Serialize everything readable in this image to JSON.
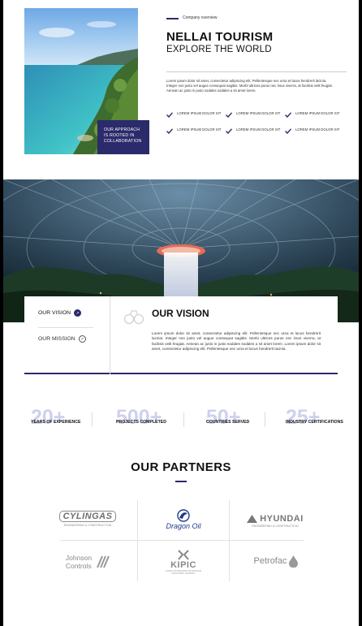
{
  "hero": {
    "approach_line1": "OUR APPROACH",
    "approach_line2": "IS ROOTED IN",
    "approach_line3": "COLLABORATION",
    "eyebrow": "Company overview",
    "title": "NELLAI TOURISM",
    "subtitle": "EXPLORE THE WORLD",
    "paragraph": "Lorem ipsum dolor sit amet, consectetur adipiscing elit. Pellentesque nec urna et lacus hendrerit lacinia. Integer non justo vel augue consequat sagittis. Morbi ultrices purus nec risus viverra, at facilisis velit feugiat. Aenean ac justo in justo sodales sodales a sit amet lorem.",
    "checks": [
      "LOREM IPSUM DOLOR SIT",
      "LOREM IPSUM DOLOR SIT",
      "LOREM IPSUM DOLOR SIT",
      "LOREM IPSUM DOLOR SIT",
      "LOREM IPSUM DOLOR SIT",
      "LOREM IPSUM DOLOR SIT"
    ]
  },
  "vision": {
    "nav_vision": "OUR VISION",
    "nav_mission": "OUR MISSION",
    "title": "OUR VISION",
    "paragraph": "Lorem ipsum dolor sit amet, consectetur adipiscing elit. Pellentesque nec urna et lacus hendrerit lacinia. Integer non justo vel augue consequat sagittis. Morbi ultrices purus nec risus viverra, at facilisis velit feugiat. Aenean ac justo in justo sodales sodales a sit amet lorem .Lorem ipsum dolor sit amet, consectetur adipiscing elit. Pellentesque nec urna et lacus hendrerit lacinia."
  },
  "stats": [
    {
      "number": "20+",
      "label": "YEARS OF EXPERIENCE"
    },
    {
      "number": "500+",
      "label": "PROJECTS COMPLETED"
    },
    {
      "number": "50+",
      "label": "COUNTRIES SERVED"
    },
    {
      "number": "25+",
      "label": "INDUSTRY CERTIFICATIONS"
    }
  ],
  "partners": {
    "title": "OUR PARTNERS",
    "logos": {
      "cylingas": "CYLINGAS",
      "cylingas_tagline": "ENGINEERING & CONSTRUCTION",
      "dragon_oil": "Dragon Oil",
      "hyundai": "HYUNDAI",
      "hyundai_tagline": "ENGINEERING & CONSTRUCTION",
      "johnson_line1": "Johnson",
      "johnson_line2": "Controls",
      "kipic": "KIPIC",
      "kipic_tagline": "KUWAIT INTEGRATED PETROLEUM INDUSTRIES COMPANY",
      "petrofac": "Petrofac"
    }
  },
  "colors": {
    "accent": "#2b2a6b",
    "stat_number": "#cfd0ef"
  }
}
